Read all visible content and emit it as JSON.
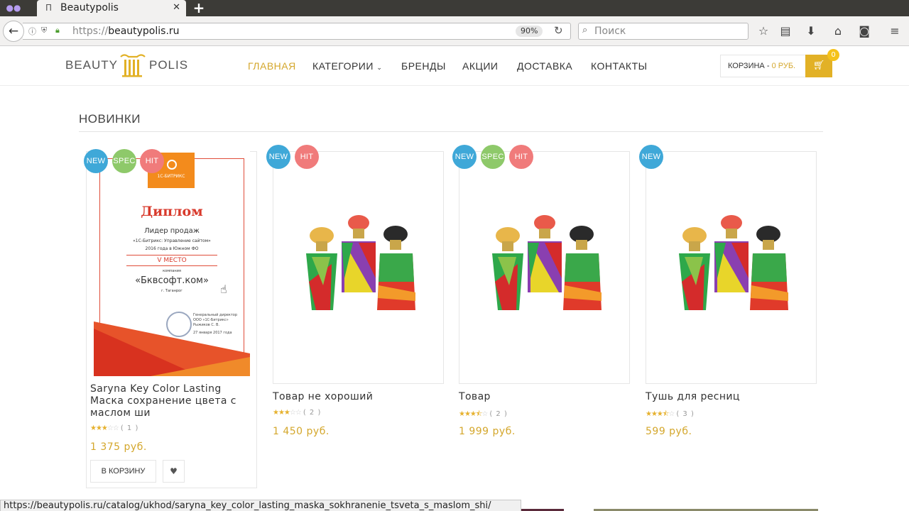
{
  "browser": {
    "tab_title": "Beautypolis",
    "url_scheme": "https://",
    "url_host": "beautypolis.ru",
    "zoom": "90%",
    "search_placeholder": "Поиск",
    "status_url": "https://beautypolis.ru/catalog/ukhod/saryna_key_color_lasting_maska_sokhranenie_tsveta_s_maslom_shi/"
  },
  "header": {
    "logo_left": "BEAUTY",
    "logo_right": "POLIS",
    "nav": [
      "ГЛАВНАЯ",
      "КАТЕГОРИИ",
      "БРЕНДЫ",
      "АКЦИИ",
      "ДОСТАВКА",
      "КОНТАКТЫ"
    ],
    "cart_label": "КОРЗИНА -",
    "cart_price": "0 РУБ.",
    "cart_count": "0"
  },
  "section": {
    "title": "НОВИНКИ"
  },
  "diploma": {
    "brand": "1С-БИТРИКС",
    "title": "Диплом",
    "line1": "Лидер продаж",
    "line2": "«1С-Битрикс: Управление сайтом»",
    "line3": "2016 года в Южном ФО",
    "place": "V МЕСТО",
    "line4": "компания",
    "company": "«Бквсофт.ком»",
    "city": "г. Таганрог",
    "sign1": "Генеральный директор",
    "sign2": "ООО «1С-Битрикс»",
    "sign3": "Рыжиков С. В.",
    "date": "27 января 2017 года"
  },
  "products": [
    {
      "name": "Saryna Key Color Lasting Маска сохранение цвета с маслом ши",
      "rating": 3,
      "reviews": "( 1 )",
      "price": "1 375 руб.",
      "badges": [
        "NEW",
        "SPEC",
        "HIT"
      ]
    },
    {
      "name": "Товар не хороший",
      "rating": 3,
      "reviews": "( 2 )",
      "price": "1 450 руб.",
      "badges": [
        "NEW",
        "HIT"
      ]
    },
    {
      "name": "Товар",
      "rating": 3.5,
      "reviews": "( 2 )",
      "price": "1 999 руб.",
      "badges": [
        "NEW",
        "SPEC",
        "HIT"
      ]
    },
    {
      "name": "Тушь для ресниц",
      "rating": 3.5,
      "reviews": "( 3 )",
      "price": "599 руб.",
      "badges": [
        "NEW"
      ]
    }
  ],
  "buttons": {
    "add_to_cart": "В КОРЗИНУ"
  },
  "colors": {
    "accent": "#d4a72c",
    "new": "#3fa8d8",
    "spec": "#8ec96a",
    "hit": "#f07b7b"
  }
}
